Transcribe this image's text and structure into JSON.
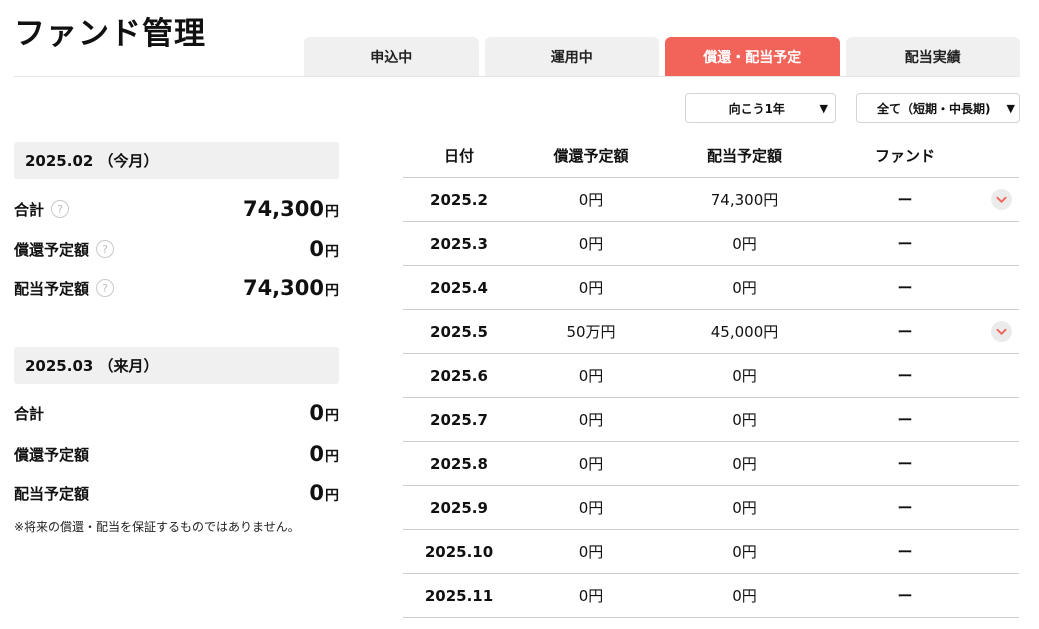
{
  "page": {
    "title": "ファンド管理"
  },
  "tabs": [
    {
      "label": "申込中",
      "active": false
    },
    {
      "label": "運用中",
      "active": false
    },
    {
      "label": "償還・配当予定",
      "active": true
    },
    {
      "label": "配当実績",
      "active": false
    }
  ],
  "filters": {
    "period": "向こう1年",
    "type": "全て（短期・中長期)"
  },
  "summary": {
    "current": {
      "heading": "2025.02 （今月）",
      "total_label": "合計",
      "total_value": "74,300",
      "repayment_label": "償還予定額",
      "repayment_value": "0",
      "dividend_label": "配当予定額",
      "dividend_value": "74,300",
      "unit": "円"
    },
    "next": {
      "heading": "2025.03 （来月）",
      "total_label": "合計",
      "total_value": "0",
      "repayment_label": "償還予定額",
      "repayment_value": "0",
      "dividend_label": "配当予定額",
      "dividend_value": "0",
      "unit": "円"
    },
    "help_glyph": "?",
    "disclaimer": "※将来の償還・配当を保証するものではありません。"
  },
  "table": {
    "headers": {
      "date": "日付",
      "repayment": "償還予定額",
      "dividend": "配当予定額",
      "fund": "ファンド"
    },
    "rows": [
      {
        "date": "2025.2",
        "repayment": "0円",
        "dividend": "74,300円",
        "fund": "ー"
      },
      {
        "date": "2025.3",
        "repayment": "0円",
        "dividend": "0円",
        "fund": "ー"
      },
      {
        "date": "2025.4",
        "repayment": "0円",
        "dividend": "0円",
        "fund": "ー"
      },
      {
        "date": "2025.5",
        "repayment": "50万円",
        "dividend": "45,000円",
        "fund": "ー"
      },
      {
        "date": "2025.6",
        "repayment": "0円",
        "dividend": "0円",
        "fund": "ー"
      },
      {
        "date": "2025.7",
        "repayment": "0円",
        "dividend": "0円",
        "fund": "ー"
      },
      {
        "date": "2025.8",
        "repayment": "0円",
        "dividend": "0円",
        "fund": "ー"
      },
      {
        "date": "2025.9",
        "repayment": "0円",
        "dividend": "0円",
        "fund": "ー"
      },
      {
        "date": "2025.10",
        "repayment": "0円",
        "dividend": "0円",
        "fund": "ー"
      },
      {
        "date": "2025.11",
        "repayment": "0円",
        "dividend": "0円",
        "fund": "ー"
      }
    ]
  },
  "colors": {
    "accent": "#f2645a",
    "tab_bg": "#f0f0f0",
    "border": "#cfcfcf"
  },
  "icons": {
    "help": "question-circle-icon",
    "expand": "chevron-down-icon",
    "caret": "caret-down-icon"
  }
}
